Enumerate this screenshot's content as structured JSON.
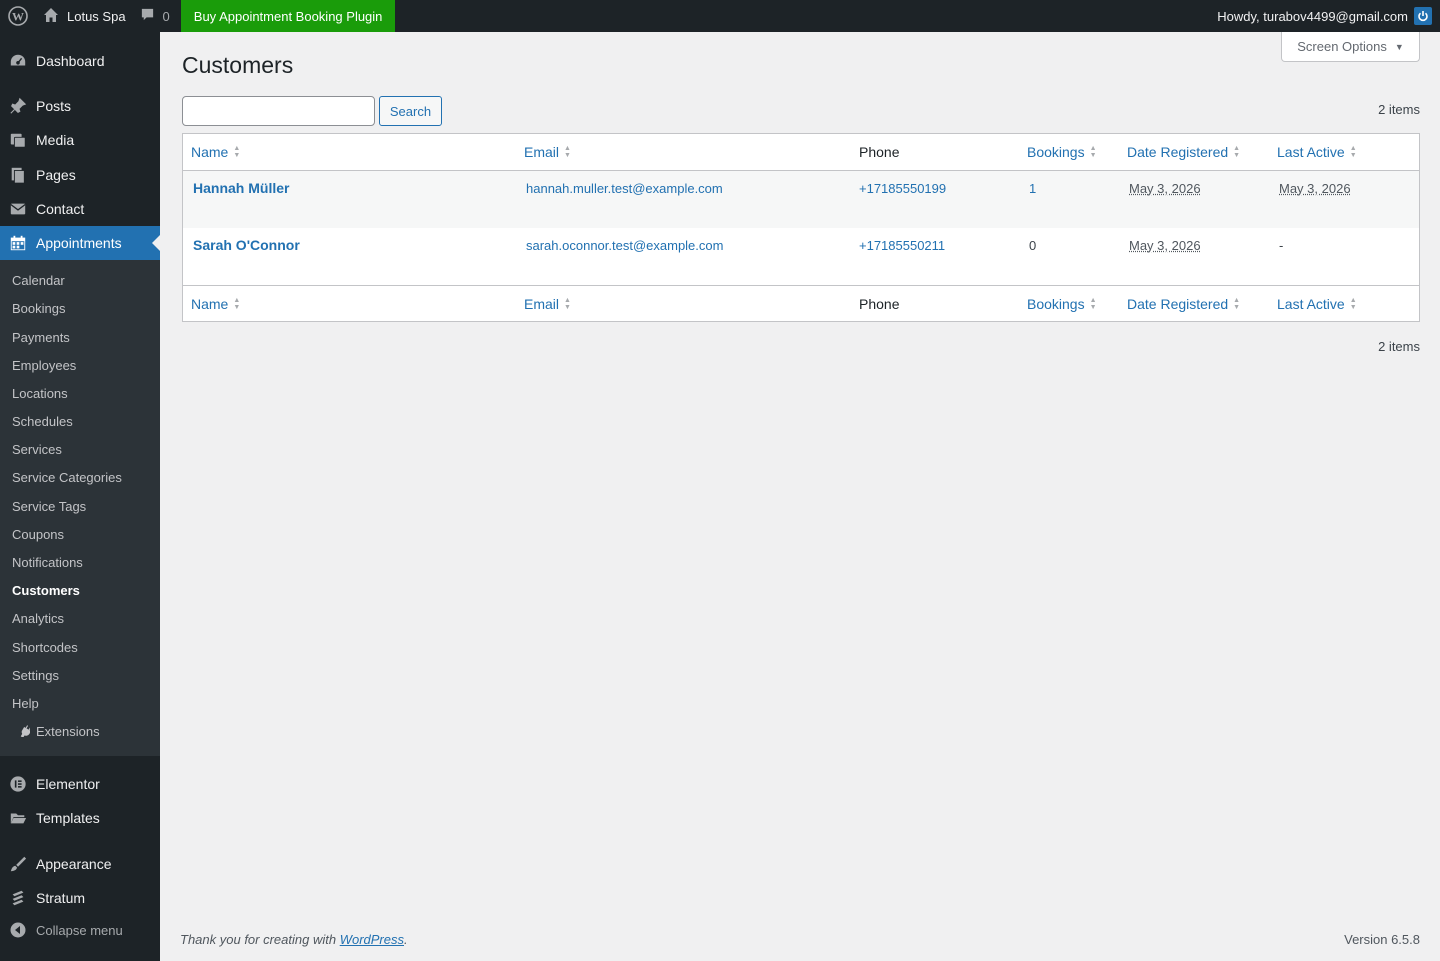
{
  "adminbar": {
    "site_name": "Lotus Spa",
    "comments_count": "0",
    "buy_label": "Buy Appointment Booking Plugin",
    "howdy": "Howdy, turabov4499@gmail.com"
  },
  "sidebar": {
    "top_items": [
      {
        "label": "Dashboard",
        "icon": "dashboard-icon"
      },
      {
        "label": "Posts",
        "icon": "pin-icon"
      },
      {
        "label": "Media",
        "icon": "media-icon"
      },
      {
        "label": "Pages",
        "icon": "pages-icon"
      },
      {
        "label": "Contact",
        "icon": "mail-icon"
      },
      {
        "label": "Appointments",
        "icon": "calendar-icon"
      }
    ],
    "submenu": [
      "Calendar",
      "Bookings",
      "Payments",
      "Employees",
      "Locations",
      "Schedules",
      "Services",
      "Service Categories",
      "Service Tags",
      "Coupons",
      "Notifications",
      "Customers",
      "Analytics",
      "Shortcodes",
      "Settings",
      "Help",
      "Extensions"
    ],
    "bottom_items": [
      {
        "label": "Elementor",
        "icon": "elementor-icon"
      },
      {
        "label": "Templates",
        "icon": "folder-icon"
      },
      {
        "label": "Appearance",
        "icon": "brush-icon"
      },
      {
        "label": "Stratum",
        "icon": "stratum-icon"
      }
    ],
    "collapse_label": "Collapse menu"
  },
  "screen_options": "Screen Options",
  "page_title": "Customers",
  "search": {
    "button": "Search",
    "placeholder": ""
  },
  "items_count": "2 items",
  "table": {
    "columns": [
      "Name",
      "Email",
      "Phone",
      "Bookings",
      "Date Registered",
      "Last Active"
    ],
    "rows": [
      {
        "name": "Hannah Müller",
        "email": "hannah.muller.test@example.com",
        "phone": "+17185550199",
        "bookings": "1",
        "date_registered": "May 3, 2026",
        "last_active": "May 3, 2026"
      },
      {
        "name": "Sarah O'Connor",
        "email": "sarah.oconnor.test@example.com",
        "phone": "+17185550211",
        "bookings": "0",
        "date_registered": "May 3, 2026",
        "last_active": "-"
      }
    ]
  },
  "footer": {
    "thanks_prefix": "Thank you for creating with ",
    "thanks_link": "WordPress",
    "thanks_suffix": ".",
    "version": "Version 6.5.8"
  },
  "colors": {
    "accent": "#2271b1",
    "buy_green": "#1a9c0a",
    "adminbar": "#1d2327"
  }
}
